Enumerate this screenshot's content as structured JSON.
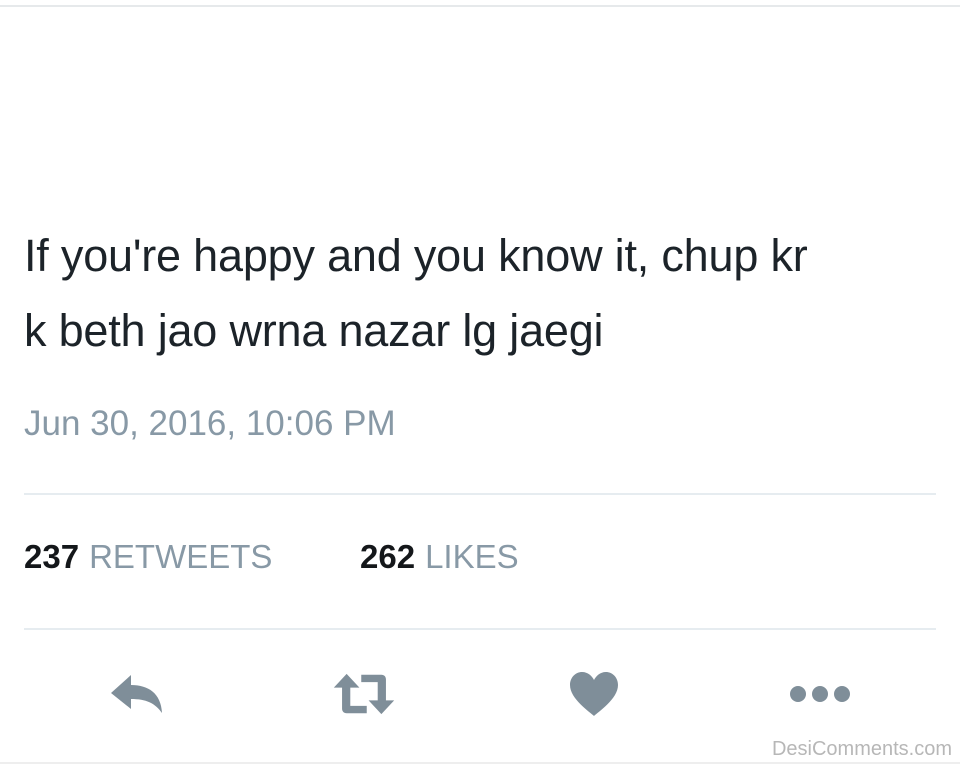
{
  "tweet": {
    "text_line1": "If you're happy and you know it, chup kr",
    "text_line2": "k beth jao wrna nazar lg jaegi",
    "timestamp": "Jun 30, 2016, 10:06 PM"
  },
  "stats": {
    "retweets_count": "237",
    "retweets_label": "RETWEETS",
    "likes_count": "262",
    "likes_label": "LIKES"
  },
  "actions": [
    {
      "name": "reply",
      "icon": "reply-icon"
    },
    {
      "name": "retweet",
      "icon": "retweet-icon"
    },
    {
      "name": "like",
      "icon": "heart-icon"
    },
    {
      "name": "more",
      "icon": "more-icon"
    }
  ],
  "colors": {
    "text": "#14171a",
    "muted": "#8899a6",
    "icon": "#7f8e99",
    "divider": "#e6ecf0"
  },
  "watermark": "DesiComments.com"
}
